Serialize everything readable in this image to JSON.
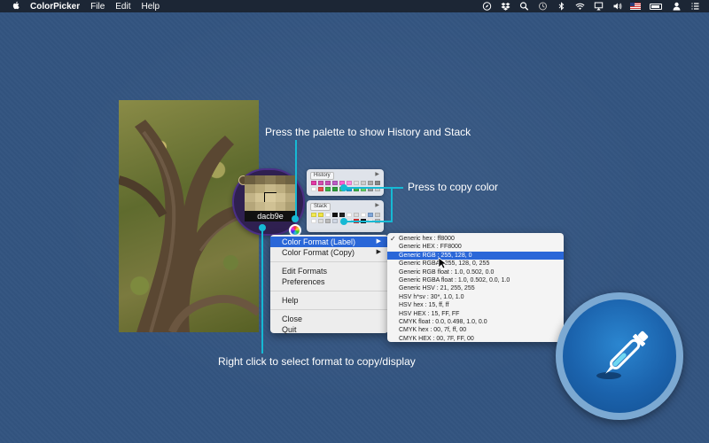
{
  "menubar": {
    "app_name": "ColorPicker",
    "menus": [
      "File",
      "Edit",
      "Help"
    ],
    "status_icons": [
      "compass-icon",
      "dropbox-icon",
      "search-icon",
      "time-machine-icon",
      "bluetooth-icon",
      "wifi-icon",
      "airplay-icon",
      "volume-icon",
      "us-flag-icon",
      "battery-icon",
      "user-icon",
      "list-icon"
    ]
  },
  "loupe": {
    "hex": "dacb9e",
    "grid_colors": [
      "#6b5e3f",
      "#7d6f4b",
      "#8a7c55",
      "#7a6b47",
      "#6e6242",
      "#a8996c",
      "#b8a979",
      "#c7b88a",
      "#bdae80",
      "#a49569",
      "#c2b386",
      "#d3c496",
      "#dacb9e",
      "#cfc093",
      "#b9aa7d",
      "#b5a67a",
      "#c6b78a",
      "#d0c194",
      "#c3b487",
      "#ad9f73"
    ]
  },
  "history": {
    "title": "History",
    "colors": [
      "#e23aa6",
      "#d24fb0",
      "#c94fb7",
      "#bb5cc6",
      "#ff5fd1",
      "#ff8de0",
      "#e0e0e0",
      "#cccccc",
      "#aaaaaa",
      "#888888",
      "#ffffff",
      "#e84c4c",
      "#3bb14a",
      "#2e9e3d",
      "#5bc05a",
      "#1ca0d8",
      "#3bb14a",
      "#66cc66",
      "#999999",
      "#cccccc"
    ]
  },
  "stack": {
    "title": "Stack",
    "colors": [
      "#f2e94f",
      "#f0e442",
      "#ffffff",
      "#111111",
      "#222222",
      "#ffffff",
      "#dddddd",
      "#ffffff",
      "#7fa6d9",
      "#cccccc",
      "#ffffff",
      "#dddddd",
      "#bbbbbb",
      "#cfd6e3",
      "#ffffff",
      "#ffffff",
      "#dd3333",
      "#111111",
      "#ffffff",
      "#bbbbbb"
    ]
  },
  "context_menu": {
    "items": [
      {
        "label": "Color Format (Label)",
        "submenu": true,
        "selected": true
      },
      {
        "label": "Color Format (Copy)",
        "submenu": true,
        "selected": false
      },
      {
        "label": "Edit Formats"
      },
      {
        "label": "Preferences"
      },
      {
        "label": "Help"
      },
      {
        "label": "Close"
      },
      {
        "label": "Quit"
      }
    ]
  },
  "submenu": {
    "items": [
      {
        "label": "Generic hex : ff8000",
        "checked": true
      },
      {
        "label": "Generic HEX : FF8000"
      },
      {
        "label": "Generic RGB : 255, 128, 0",
        "selected": true
      },
      {
        "label": "Generic RGBA : 255, 128, 0, 255"
      },
      {
        "label": "Generic RGB float : 1.0, 0.502, 0.0"
      },
      {
        "label": "Generic RGBA float : 1.0, 0.502, 0.0, 1.0"
      },
      {
        "label": "Generic HSV : 21, 255, 255"
      },
      {
        "label": "HSV h*sv : 30*, 1.0, 1.0"
      },
      {
        "label": "HSV hex : 15, ff, ff"
      },
      {
        "label": "HSV HEX : 15, FF, FF"
      },
      {
        "label": "CMYK float : 0.0, 0.498, 1.0, 0.0"
      },
      {
        "label": "CMYK hex : 00, 7f, ff, 00"
      },
      {
        "label": "CMYK HEX : 00, 7F, FF, 00"
      }
    ]
  },
  "annotations": {
    "palette_note": "Press the palette to show History and Stack",
    "copy_note": "Press to copy color",
    "format_note": "Right click to select format to copy/display"
  },
  "colors": {
    "desktop": "#335480",
    "accent": "#16b9d4",
    "menu_selection": "#2a67d8"
  }
}
